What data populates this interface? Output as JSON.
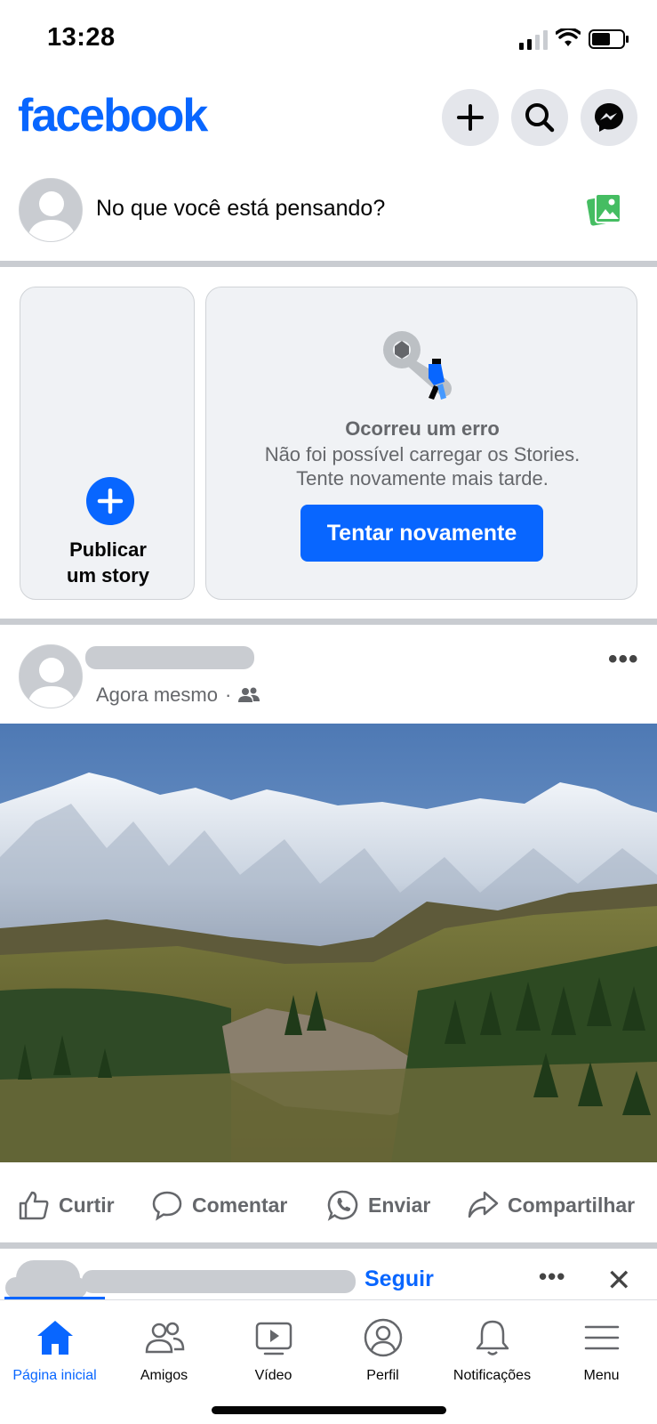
{
  "status_bar": {
    "time": "13:28"
  },
  "header": {
    "logo": "facebook",
    "buttons": [
      "add-icon",
      "search-icon",
      "messenger-icon"
    ]
  },
  "composer": {
    "placeholder": "No que você está pensando?"
  },
  "stories": {
    "create_label": "Publicar\num story",
    "error_title": "Ocorreu um erro",
    "error_message": "Não foi possível carregar os Stories.\nTente novamente mais tarde.",
    "retry_label": "Tentar novamente"
  },
  "post": {
    "time": "Agora mesmo",
    "separator": "·",
    "actions": {
      "like": "Curtir",
      "comment": "Comentar",
      "send": "Enviar",
      "share": "Compartilhar"
    }
  },
  "next_post": {
    "follow": "Seguir"
  },
  "tabbar": {
    "items": [
      {
        "label": "Página inicial",
        "active": true
      },
      {
        "label": "Amigos"
      },
      {
        "label": "Vídeo"
      },
      {
        "label": "Perfil"
      },
      {
        "label": "Notificações"
      },
      {
        "label": "Menu"
      }
    ]
  },
  "colors": {
    "brand": "#0866ff",
    "muted": "#65676b",
    "divider": "#c9ccd1"
  }
}
